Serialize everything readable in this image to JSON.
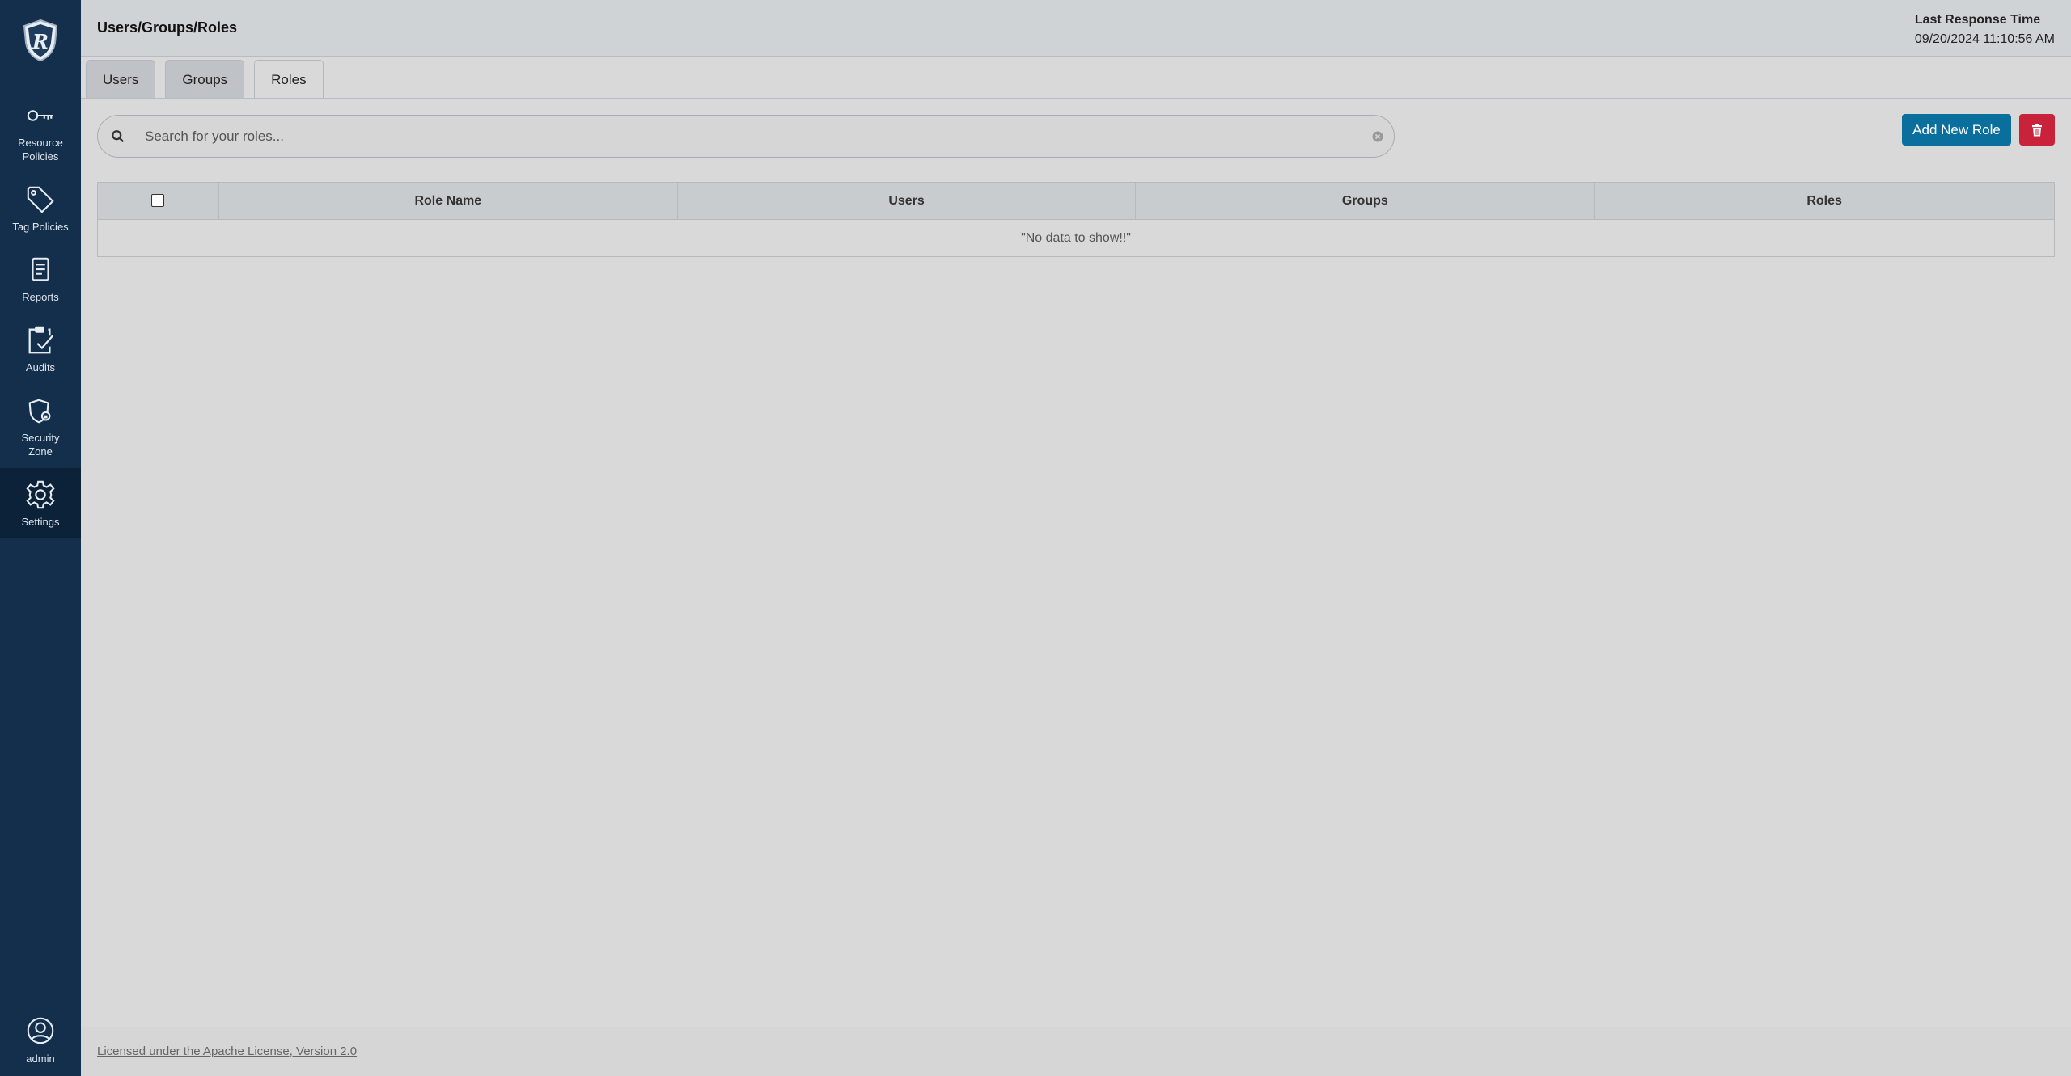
{
  "header": {
    "title": "Users/Groups/Roles",
    "response_label": "Last Response Time",
    "response_value": "09/20/2024 11:10:56 AM"
  },
  "sidebar": {
    "items": [
      {
        "label": "Resource Policies",
        "icon": "key-icon"
      },
      {
        "label": "Tag Policies",
        "icon": "tag-icon"
      },
      {
        "label": "Reports",
        "icon": "report-icon"
      },
      {
        "label": "Audits",
        "icon": "clipboard-check-icon"
      },
      {
        "label": "Security Zone",
        "icon": "shield-lock-icon"
      },
      {
        "label": "Settings",
        "icon": "gear-icon",
        "active": true
      }
    ],
    "user": {
      "label": "admin",
      "icon": "user-circle-icon"
    }
  },
  "tabs": [
    {
      "label": "Users"
    },
    {
      "label": "Groups"
    },
    {
      "label": "Roles",
      "active": true
    }
  ],
  "search": {
    "placeholder": "Search for your roles..."
  },
  "actions": {
    "add_label": "Add New Role"
  },
  "table": {
    "columns": [
      "Role Name",
      "Users",
      "Groups",
      "Roles"
    ],
    "empty_text": "\"No data to show!!\""
  },
  "footer": {
    "license_text": "Licensed under the Apache License, Version 2.0"
  },
  "colors": {
    "sidebar": "#132f4c",
    "primary": "#0b6f9e",
    "danger": "#c8233a"
  }
}
